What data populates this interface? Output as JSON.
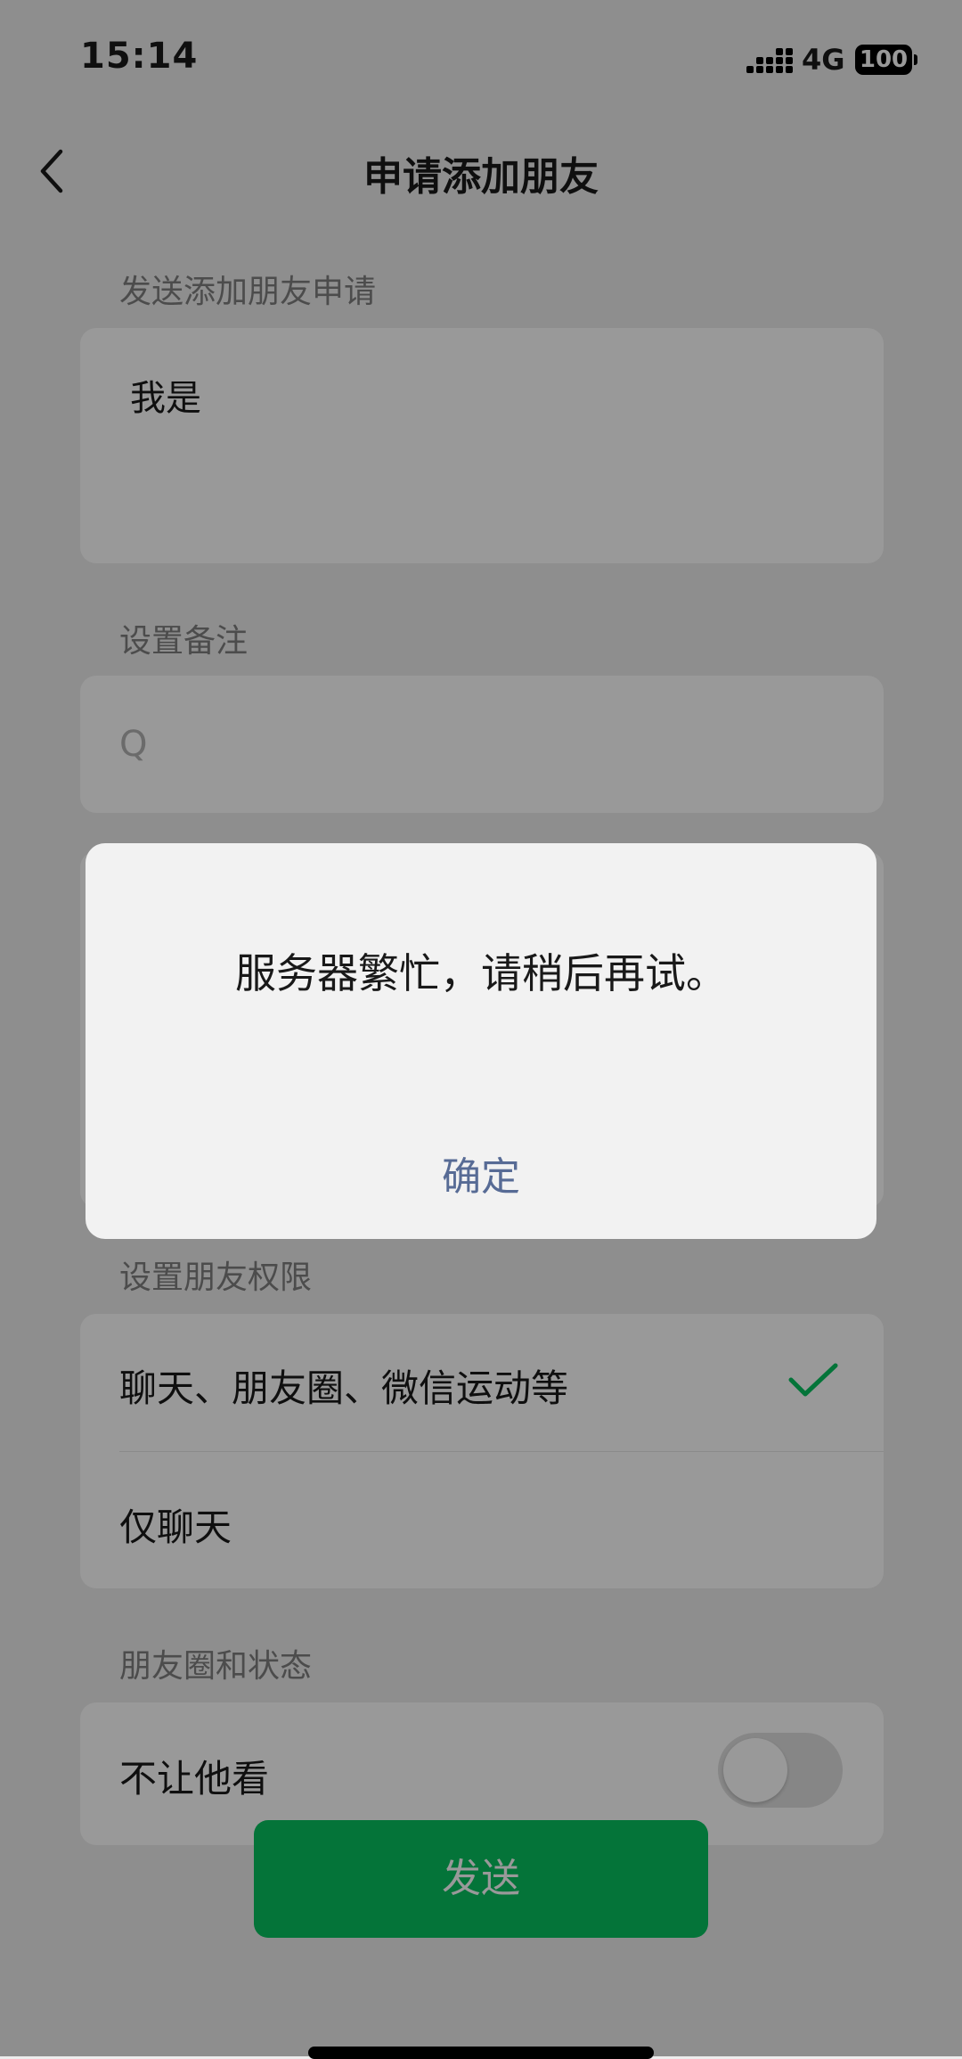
{
  "status_bar": {
    "time": "15:14",
    "network": "4G",
    "battery": "100"
  },
  "nav": {
    "title": "申请添加朋友",
    "back_icon": "chevron-left-icon"
  },
  "greeting_section": {
    "label": "发送添加朋友申请",
    "value": "我是"
  },
  "remark_section": {
    "label": "设置备注",
    "value": "Q"
  },
  "permission_section": {
    "label": "设置朋友权限",
    "options": [
      {
        "label": "聊天、朋友圈、微信运动等",
        "selected": true
      },
      {
        "label": "仅聊天",
        "selected": false
      }
    ]
  },
  "moments_section": {
    "label": "朋友圈和状态",
    "hide_from_label": "不让他看",
    "hide_from_enabled": false
  },
  "send_button": {
    "label": "发送"
  },
  "dialog": {
    "message": "服务器繁忙，请稍后再试。",
    "confirm_label": "确定"
  },
  "colors": {
    "accent": "#07c160",
    "link": "#576b95",
    "background": "#ededed"
  }
}
